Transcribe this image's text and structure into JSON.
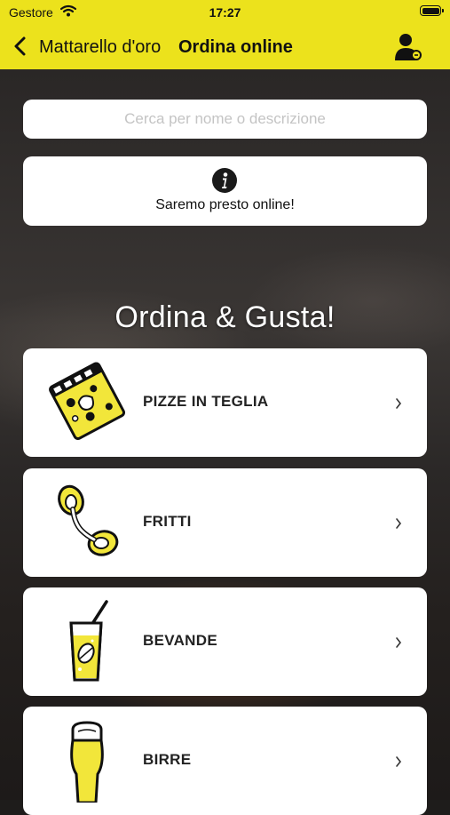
{
  "status_bar": {
    "carrier": "Gestore",
    "time": "17:27"
  },
  "nav": {
    "back_label": "Mattarello d'oro",
    "title": "Ordina online"
  },
  "search": {
    "placeholder": "Cerca per nome o descrizione"
  },
  "notice": {
    "text": "Saremo presto online!"
  },
  "heading": "Ordina & Gusta!",
  "categories": [
    {
      "label": "PIZZE IN TEGLIA",
      "icon": "pizza-slice-icon"
    },
    {
      "label": "FRITTI",
      "icon": "fried-food-icon"
    },
    {
      "label": "BEVANDE",
      "icon": "drink-glass-icon"
    },
    {
      "label": "BIRRE",
      "icon": "beer-glass-icon"
    }
  ],
  "colors": {
    "accent": "#ece21c",
    "icon_yellow": "#f2e63a",
    "ink": "#111111"
  }
}
